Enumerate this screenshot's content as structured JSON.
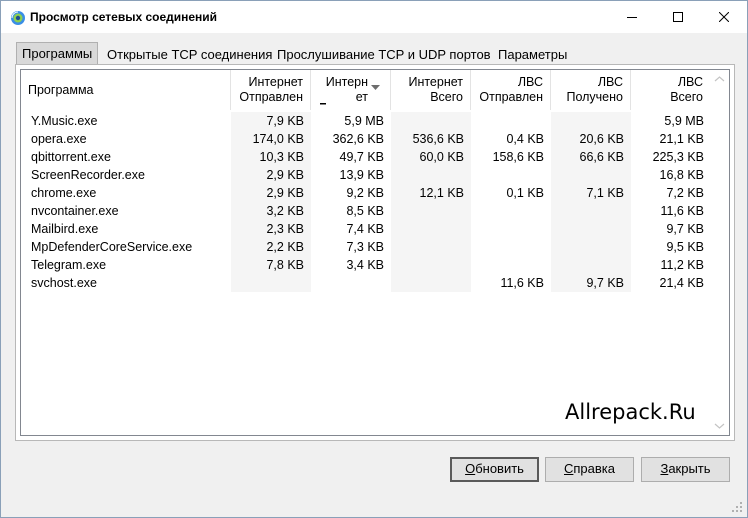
{
  "window": {
    "title": "Просмотр сетевых соединений",
    "icon": "network-monitor-icon"
  },
  "tabs": [
    {
      "label": "Программы",
      "active": true
    },
    {
      "label": "Открытые TCP соединения",
      "active": false
    },
    {
      "label": "Прослушивание TCP и UDP портов",
      "active": false
    },
    {
      "label": "Параметры",
      "active": false
    }
  ],
  "table": {
    "columns": [
      {
        "label": "Программа"
      },
      {
        "label": "Интернет\nОтправлен"
      },
      {
        "label": "Интерн\nет",
        "sorted": "desc"
      },
      {
        "label": "Интернет\nВсего"
      },
      {
        "label": "ЛВС\nОтправлен"
      },
      {
        "label": "ЛВС\nПолучено"
      },
      {
        "label": "ЛВС\nВсего"
      }
    ],
    "rows": [
      {
        "program": "Y.Music.exe",
        "inet_sent": "7,9 KB",
        "inet_recv": "5,9 MB",
        "inet_total": "",
        "lan_sent": "",
        "lan_recv": "",
        "lan_total": "5,9 MB"
      },
      {
        "program": "opera.exe",
        "inet_sent": "174,0 KB",
        "inet_recv": "362,6 KB",
        "inet_total": "536,6 KB",
        "lan_sent": "0,4 KB",
        "lan_recv": "20,6 KB",
        "lan_total": "21,1 KB"
      },
      {
        "program": "qbittorrent.exe",
        "inet_sent": "10,3 KB",
        "inet_recv": "49,7 KB",
        "inet_total": "60,0 KB",
        "lan_sent": "158,6 KB",
        "lan_recv": "66,6 KB",
        "lan_total": "225,3 KB"
      },
      {
        "program": "ScreenRecorder.exe",
        "inet_sent": "2,9 KB",
        "inet_recv": "13,9 KB",
        "inet_total": "",
        "lan_sent": "",
        "lan_recv": "",
        "lan_total": "16,8 KB"
      },
      {
        "program": "chrome.exe",
        "inet_sent": "2,9 KB",
        "inet_recv": "9,2 KB",
        "inet_total": "12,1 KB",
        "lan_sent": "0,1 KB",
        "lan_recv": "7,1 KB",
        "lan_total": "7,2 KB"
      },
      {
        "program": "nvcontainer.exe",
        "inet_sent": "3,2 KB",
        "inet_recv": "8,5 KB",
        "inet_total": "",
        "lan_sent": "",
        "lan_recv": "",
        "lan_total": "11,6 KB"
      },
      {
        "program": "Mailbird.exe",
        "inet_sent": "2,3 KB",
        "inet_recv": "7,4 KB",
        "inet_total": "",
        "lan_sent": "",
        "lan_recv": "",
        "lan_total": "9,7 KB"
      },
      {
        "program": "MpDefenderCoreService.exe",
        "inet_sent": "2,2 KB",
        "inet_recv": "7,3 KB",
        "inet_total": "",
        "lan_sent": "",
        "lan_recv": "",
        "lan_total": "9,5 KB"
      },
      {
        "program": "Telegram.exe",
        "inet_sent": "7,8 KB",
        "inet_recv": "3,4 KB",
        "inet_total": "",
        "lan_sent": "",
        "lan_recv": "",
        "lan_total": "11,2 KB"
      },
      {
        "program": "svchost.exe",
        "inet_sent": "",
        "inet_recv": "",
        "inet_total": "",
        "lan_sent": "11,6 KB",
        "lan_recv": "9,7 KB",
        "lan_total": "21,4 KB"
      }
    ]
  },
  "watermark": "Allrepack.Ru",
  "buttons": {
    "refresh": {
      "accel": "О",
      "rest": "бновить"
    },
    "help": {
      "accel": "С",
      "rest": "правка"
    },
    "close": {
      "accel": "З",
      "rest": "акрыть"
    }
  },
  "colors": {
    "row_shade": "#f5f5f5",
    "tab_active": "#d9d9d9"
  }
}
